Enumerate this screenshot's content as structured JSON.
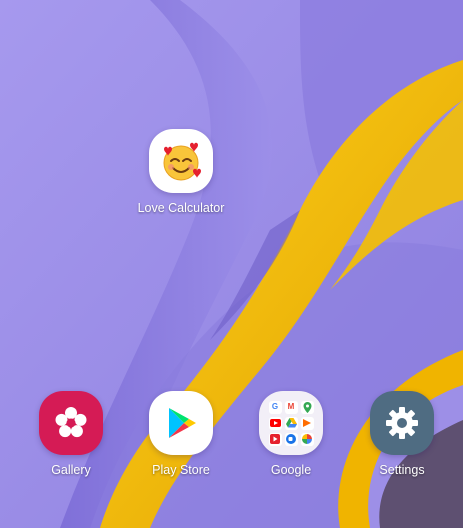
{
  "home_screen": {
    "apps": [
      {
        "label": "Love Calculator",
        "icon": "smiling-face-with-hearts-icon",
        "icon_bg": "#ffffff"
      },
      {
        "label": "Gallery",
        "icon": "flower-icon",
        "icon_bg": "#d51b55"
      },
      {
        "label": "Play Store",
        "icon": "play-triangle-icon",
        "icon_bg": "#ffffff"
      },
      {
        "label": "Google",
        "icon": "app-folder-icon",
        "icon_bg": "#f2eff7"
      },
      {
        "label": "Settings",
        "icon": "gear-icon",
        "icon_bg": "#4f6c82"
      }
    ]
  },
  "colors": {
    "wallpaper_purple": "#9d8fe7",
    "wallpaper_yellow": "#f5b800",
    "label_text": "#ffffff"
  }
}
